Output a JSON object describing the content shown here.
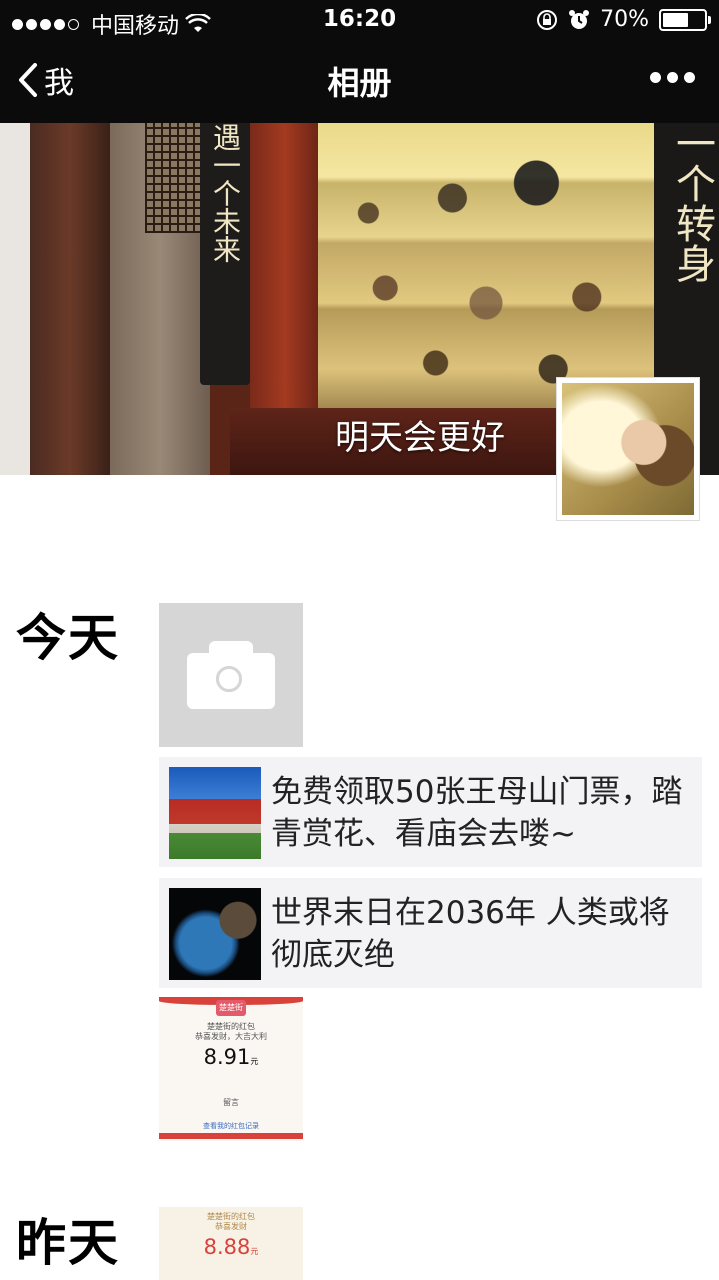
{
  "status_bar": {
    "carrier": "中国移动",
    "time": "16:20",
    "battery_percent": "70%",
    "battery_level": 0.7,
    "signal_dots_filled": 4,
    "signal_dots_total": 5
  },
  "nav": {
    "back_label": "我",
    "title": "相册"
  },
  "cover": {
    "caption": "明天会更好",
    "sign_left": "遇一个未来",
    "sign_right": "一个转身"
  },
  "feed": {
    "today_label": "今天",
    "yesterday_label": "昨天",
    "articles": [
      {
        "text": "免费领取50张王母山门票，踏青赏花、看庙会去喽~"
      },
      {
        "text": "世界末日在2036年 人类或将彻底灭绝"
      }
    ],
    "red_packet_today": {
      "badge": "楚楚街",
      "title": "楚楚街的红包",
      "subtitle": "恭喜发财，大吉大利",
      "amount": "8.91",
      "unit": "元",
      "note": "留言",
      "link": "查看我的红包记录"
    },
    "red_packet_yesterday": {
      "title": "楚楚街的红包",
      "subtitle": "恭喜发财",
      "amount": "8.88",
      "unit": "元"
    }
  },
  "colors": {
    "topbar_bg": "#0b0b0b",
    "article_bg": "#f3f3f5",
    "red_packet_red": "#d8423a",
    "placeholder_gray": "#d6d6d6"
  }
}
